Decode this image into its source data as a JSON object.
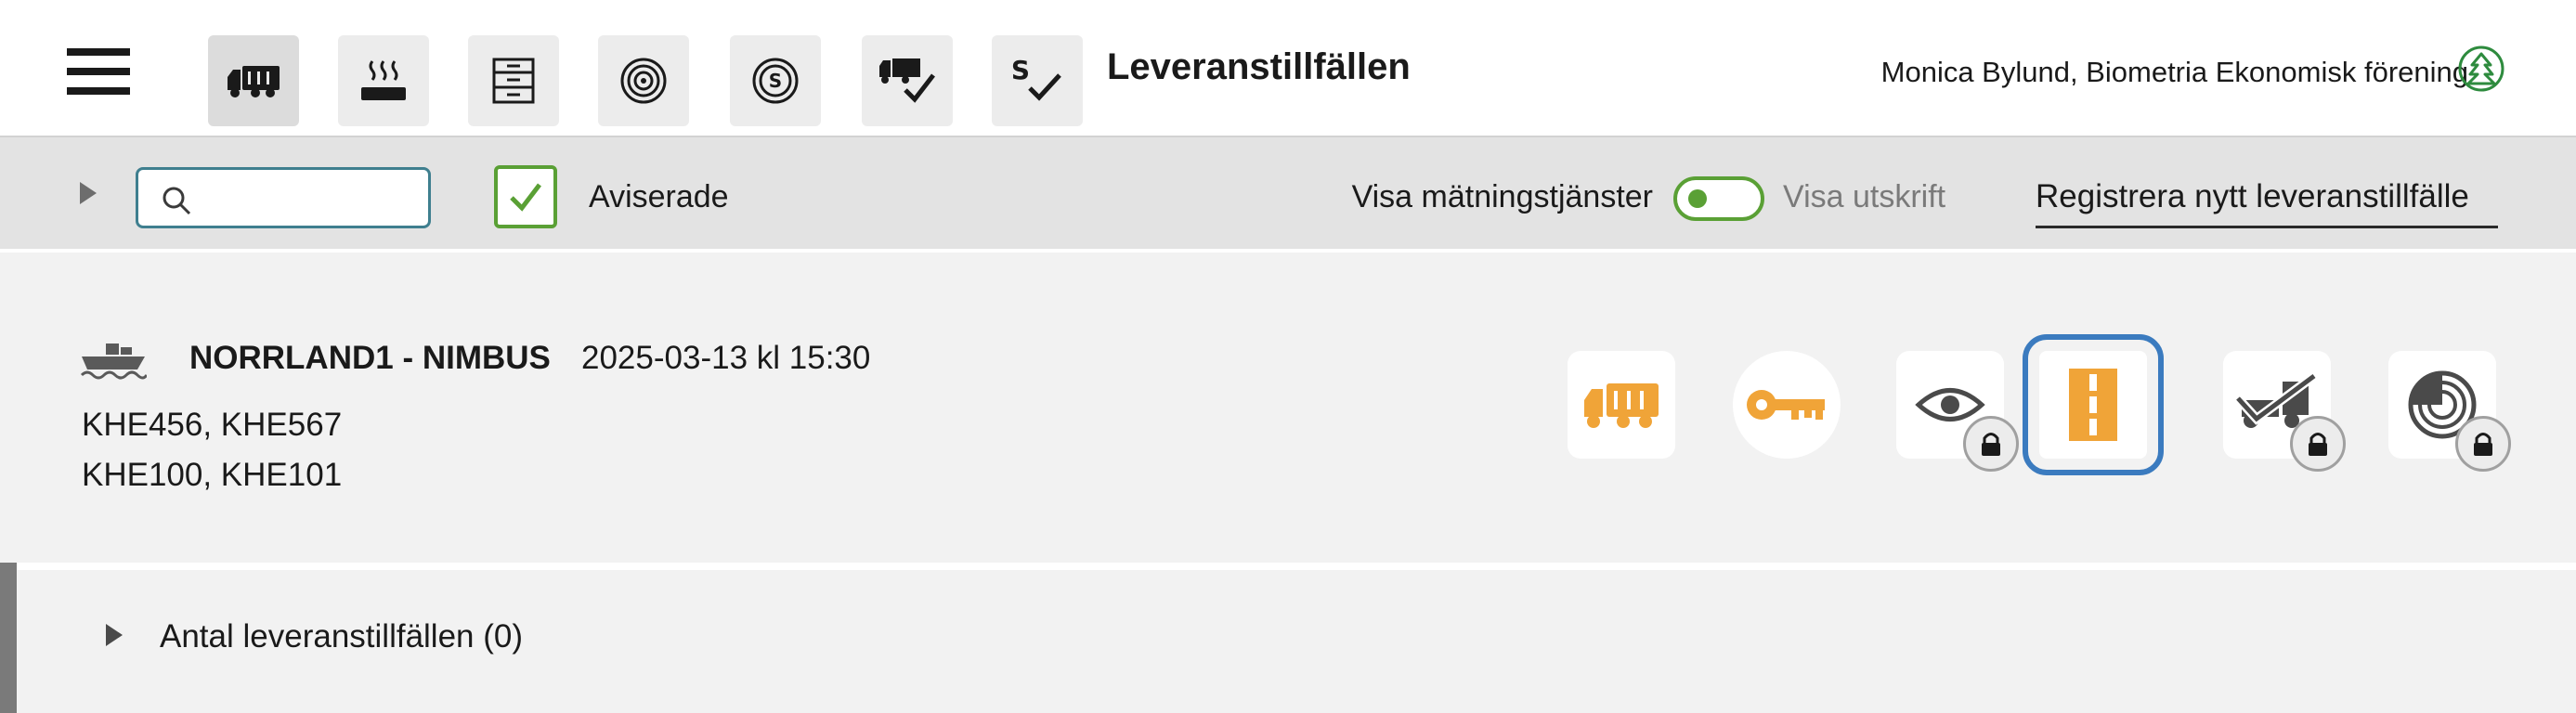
{
  "header": {
    "title": "Leveranstillfällen",
    "user": "Monica Bylund, Biometria Ekonomisk förening",
    "nav_icons": [
      "truck-icon",
      "steam-icon",
      "cabinet-icon",
      "log-rings-icon",
      "coin-icon",
      "truck-check-icon",
      "s-check-icon"
    ],
    "active_nav": "truck-icon"
  },
  "toolbar": {
    "search_placeholder": "",
    "search_value": "",
    "checkbox_label": "Aviserade",
    "checkbox_checked": true,
    "toggle_left_label": "Visa mätningstjänster",
    "toggle_right_label": "Visa utskrift",
    "toggle_on": false,
    "register_link": "Registrera nytt leveranstillfälle"
  },
  "card": {
    "icon": "boat-icon",
    "name": "NORRLAND1 - NIMBUS",
    "datetime": "2025-03-13 kl 15:30",
    "line1": "KHE456, KHE567",
    "line2": "KHE100, KHE101",
    "actions": [
      {
        "icon": "truck-icon",
        "locked": false,
        "selected": false
      },
      {
        "icon": "key-icon",
        "locked": false,
        "selected": false
      },
      {
        "icon": "eye-icon",
        "locked": true,
        "selected": false
      },
      {
        "icon": "road-icon",
        "locked": false,
        "selected": true
      },
      {
        "icon": "forwarder-check-icon",
        "locked": true,
        "selected": false
      },
      {
        "icon": "log-measure-icon",
        "locked": true,
        "selected": false
      }
    ]
  },
  "count_row": {
    "label": "Antal leveranstillfällen (0)"
  },
  "colors": {
    "accent_green": "#5aa035",
    "accent_orange": "#f0a438",
    "selection_blue": "#3b7bbf",
    "search_border": "#3f7f8f",
    "toolbar_bg": "#e3e3e3",
    "card_bg": "#f2f2f2"
  }
}
